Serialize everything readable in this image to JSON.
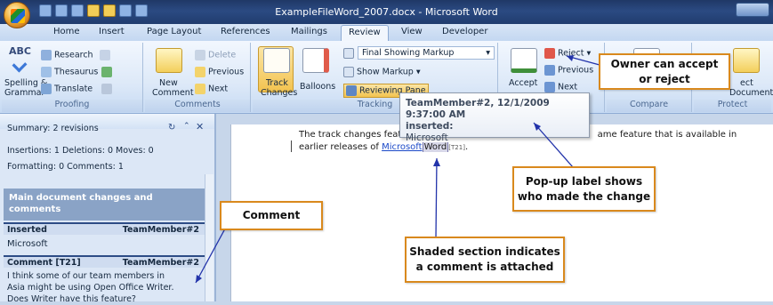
{
  "window": {
    "title": "ExampleFileWord_2007.docx - Microsoft Word"
  },
  "tabs": [
    "Home",
    "Insert",
    "Page Layout",
    "References",
    "Mailings",
    "Review",
    "View",
    "Developer"
  ],
  "active_tab": "Review",
  "ribbon": {
    "proofing": {
      "spelling": "Spelling &",
      "grammar": "Grammar",
      "research": "Research",
      "thesaurus": "Thesaurus",
      "translate": "Translate",
      "abc": "ABC",
      "label": "Proofing"
    },
    "comments": {
      "new_comment_1": "New",
      "new_comment_2": "Comment",
      "delete": "Delete",
      "previous": "Previous",
      "next": "Next",
      "label": "Comments"
    },
    "tracking": {
      "track_changes_1": "Track",
      "track_changes_2": "Changes",
      "balloons": "Balloons",
      "final_showing_markup": "Final Showing Markup",
      "show_markup": "Show Markup",
      "reviewing_pane": "Reviewing Pane",
      "label": "Tracking"
    },
    "changes": {
      "accept": "Accept",
      "reject": "Reject",
      "previous": "Previous",
      "next": "Next"
    },
    "compare": {
      "label": "Compare"
    },
    "protect": {
      "doc_1": "ect",
      "doc_2": "Document",
      "label": "Protect"
    }
  },
  "reviewing_pane": {
    "summary": "Summary: 2 revisions",
    "counts_1": "Insertions: 1  Deletions: 0  Moves: 0",
    "counts_2": "Formatting: 0  Comments: 1",
    "section_title": "Main document changes and comments",
    "revisions": [
      {
        "type": "Inserted",
        "author": "TeamMember#2",
        "body": "Microsoft"
      },
      {
        "type": "Comment [T21]",
        "author": "TeamMember#2",
        "body_1": "I think some of our team members in",
        "body_2": "Asia might be using Open Office Writer.",
        "body_3": "Does Writer have this feature?"
      }
    ]
  },
  "document": {
    "line1_start": "The track changes featu",
    "line1_end": "ame feature that is available in",
    "line2_start": "earlier releases of ",
    "inserted_text": "Microsoft",
    "commented_text": "Word",
    "comment_mark": "[T21]",
    "line2_end": "."
  },
  "tooltip": {
    "header": "TeamMember#2, 12/1/2009 9:37:00 AM",
    "action": "inserted:",
    "text": "Microsoft"
  },
  "callouts": {
    "owner": [
      "Owner can accept",
      "or reject"
    ],
    "comment": "Comment",
    "popup": [
      "Pop-up label shows",
      "who made the change"
    ],
    "shaded": [
      "Shaded section indicates",
      "a comment is attached"
    ]
  },
  "colors": {
    "callout_border": "#d9891d",
    "insert_text": "#1b49c8",
    "ribbon_bg": "#dde9f8"
  }
}
